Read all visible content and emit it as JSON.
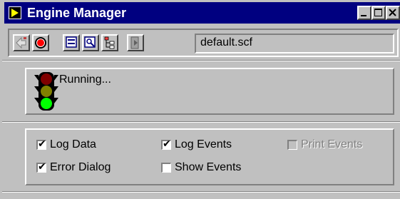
{
  "window": {
    "title": "Engine Manager",
    "controls": {
      "minimize": "minimize-icon",
      "maximize": "maximize-icon",
      "close": "close-icon"
    }
  },
  "toolbar": {
    "icons": [
      "edit-arrow-icon",
      "stop-icon",
      "display-icon",
      "search-icon",
      "tree-icon",
      "exit-icon"
    ],
    "file_name": "default.scf"
  },
  "status": {
    "indicator": "traffic-light-icon",
    "text": "Running..."
  },
  "options": {
    "log_data": {
      "label": "Log Data",
      "checked": true,
      "enabled": true
    },
    "log_events": {
      "label": "Log Events",
      "checked": true,
      "enabled": true
    },
    "print_events": {
      "label": "Print Events",
      "checked": false,
      "enabled": false
    },
    "error_dialog": {
      "label": "Error Dialog",
      "checked": true,
      "enabled": true
    },
    "show_events": {
      "label": "Show Events",
      "checked": false,
      "enabled": true
    }
  },
  "colors": {
    "titlebar": "#000080",
    "face": "#c0c0c0",
    "light_red": "#ff0000",
    "light_green": "#00ff00"
  }
}
